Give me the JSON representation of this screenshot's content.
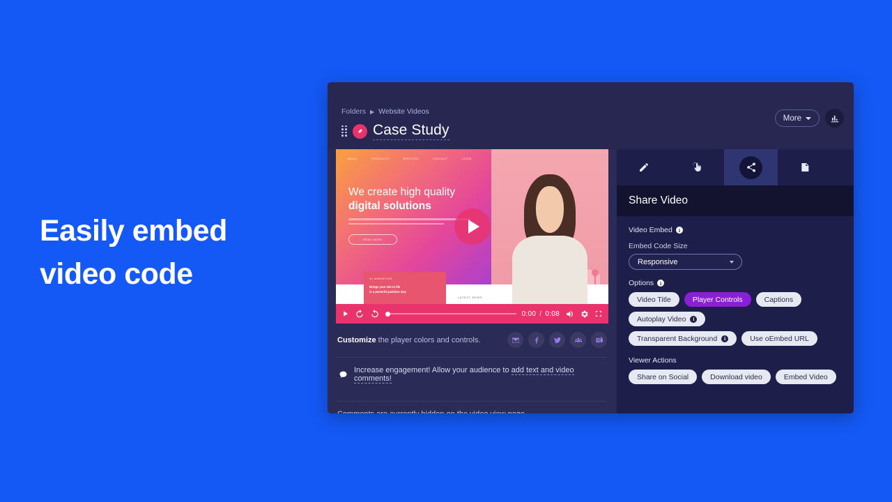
{
  "promo": {
    "line1": "Easily embed",
    "line2": "video code",
    "bg_color": "#1459f5"
  },
  "header": {
    "breadcrumb": {
      "root": "Folders",
      "separator": "▶",
      "current": "Website Videos"
    },
    "title": "Case Study",
    "more_label": "More",
    "drag_handle_icon": "grip-dots-icon",
    "link_icon": "link-chain-icon",
    "analytics_icon": "analytics-chart-icon"
  },
  "player": {
    "thumbnail": {
      "nav": [
        "ABOUT",
        "PRODUCTS",
        "SERVICES",
        "CONTACT",
        "LOGIN"
      ],
      "heading_line1": "We create high quality",
      "heading_line2": "digital solutions",
      "cta": "READ MORE",
      "card_eyebrow": "4U MARKETING",
      "card_line1": "Brings your site to life",
      "card_line2": "in a powerful painless way",
      "latest_news": "LATEST NEWS"
    },
    "play_icon": "play-icon",
    "controls": {
      "play_icon": "play-icon",
      "rewind_icon": "rewind-10-icon",
      "forward_icon": "forward-10-icon",
      "current_time": "0:00",
      "separator": "/",
      "duration": "0:08",
      "volume_icon": "volume-icon",
      "settings_icon": "gear-icon",
      "fullscreen_icon": "fullscreen-icon",
      "progress_percent": 0
    },
    "customize": {
      "link_text": "Customize",
      "rest_text": " the player colors and controls.",
      "socials": [
        {
          "name": "email-icon",
          "label": "Email"
        },
        {
          "name": "facebook-icon",
          "label": "Facebook"
        },
        {
          "name": "twitter-icon",
          "label": "Twitter"
        },
        {
          "name": "group-icon",
          "label": "Group"
        },
        {
          "name": "teams-icon",
          "label": "Microsoft Teams"
        }
      ]
    },
    "engagement": {
      "icon": "comment-bubble-icon",
      "text_before": "Increase engagement! Allow your audience to ",
      "link_text": "add text and video comments!"
    },
    "comments_status": "Comments are currently hidden on the video view page"
  },
  "share_panel": {
    "tabs": [
      {
        "id": "edit",
        "icon": "pencil-icon",
        "active": false
      },
      {
        "id": "interactive",
        "icon": "hand-click-icon",
        "active": false
      },
      {
        "id": "share",
        "icon": "share-nodes-icon",
        "active": true
      },
      {
        "id": "notes",
        "icon": "note-page-icon",
        "active": false
      },
      {
        "id": "more",
        "icon": "more-tab-icon",
        "active": false
      }
    ],
    "heading": "Share Video",
    "video_embed_label": "Video Embed",
    "embed_size_label": "Embed Code Size",
    "embed_size_value": "Responsive",
    "options_label": "Options",
    "options": [
      {
        "label": "Video Title",
        "active": false,
        "info": false
      },
      {
        "label": "Player Controls",
        "active": true,
        "info": false
      },
      {
        "label": "Captions",
        "active": false,
        "info": false
      },
      {
        "label": "Autoplay Video",
        "active": false,
        "info": true
      },
      {
        "label": "Transparent Background",
        "active": false,
        "info": true
      },
      {
        "label": "Use oEmbed URL",
        "active": false,
        "info": false
      }
    ],
    "viewer_actions_label": "Viewer Actions",
    "viewer_actions": [
      {
        "label": "Share on Social"
      },
      {
        "label": "Download video"
      },
      {
        "label": "Embed Video"
      }
    ],
    "colors": {
      "active_pill": "#8b1fd4",
      "panel_bg": "#1e1e4b",
      "accent": "#e8336d"
    }
  }
}
